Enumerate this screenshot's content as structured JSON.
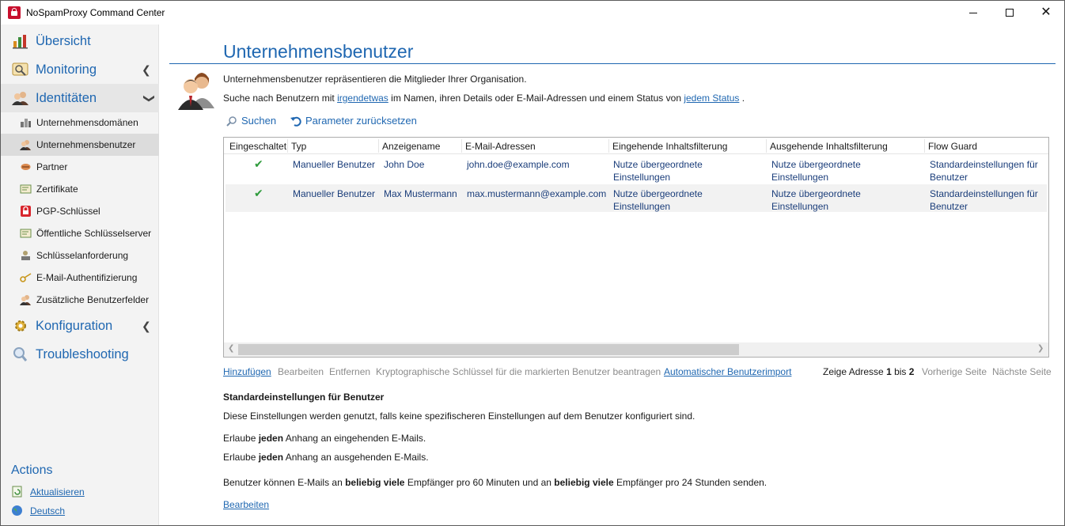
{
  "window": {
    "title": "NoSpamProxy Command Center"
  },
  "sidebar": {
    "main_items": [
      {
        "label": "Übersicht"
      },
      {
        "label": "Monitoring"
      },
      {
        "label": "Identitäten"
      },
      {
        "label": "Konfiguration"
      },
      {
        "label": "Troubleshooting"
      }
    ],
    "sub_items": [
      {
        "label": "Unternehmensdomänen"
      },
      {
        "label": "Unternehmensbenutzer"
      },
      {
        "label": "Partner"
      },
      {
        "label": "Zertifikate"
      },
      {
        "label": "PGP-Schlüssel"
      },
      {
        "label": "Öffentliche Schlüsselserver"
      },
      {
        "label": "Schlüsselanforderung"
      },
      {
        "label": "E-Mail-Authentifizierung"
      },
      {
        "label": "Zusätzliche Benutzerfelder"
      }
    ],
    "actions_title": "Actions",
    "actions": [
      {
        "label": "Aktualisieren"
      },
      {
        "label": "Deutsch"
      }
    ]
  },
  "main": {
    "title": "Unternehmensbenutzer",
    "intro": "Unternehmensbenutzer repräsentieren die Mitglieder Ihrer Organisation.",
    "search": {
      "prefix": "Suche nach Benutzern mit",
      "link1": "irgendetwas",
      "middle": "im Namen, ihren Details oder E-Mail-Adressen und einem Status von",
      "link2": "jedem Status",
      "suffix": "."
    },
    "toolbar": {
      "search_label": "Suchen",
      "reset_label": "Parameter zurücksetzen"
    },
    "grid": {
      "columns": [
        "Eingeschaltet",
        "Typ",
        "Anzeigename",
        "E-Mail-Adressen",
        "Eingehende Inhaltsfilterung",
        "Ausgehende Inhaltsfilterung",
        "Flow Guard"
      ],
      "rows": [
        {
          "enabled": true,
          "type": "Manueller Benutzer",
          "name": "John Doe",
          "email": "john.doe@example.com",
          "inbound_1": "Nutze übergeordnete",
          "inbound_2": "Einstellungen",
          "outbound_1": "Nutze übergeordnete",
          "outbound_2": "Einstellungen",
          "flow_1": "Standardeinstellungen für",
          "flow_2": "Benutzer"
        },
        {
          "enabled": true,
          "type": "Manueller Benutzer",
          "name": "Max Mustermann",
          "email": "max.mustermann@example.com",
          "inbound_1": "Nutze übergeordnete",
          "inbound_2": "Einstellungen",
          "outbound_1": "Nutze übergeordnete",
          "outbound_2": "Einstellungen",
          "flow_1": "Standardeinstellungen für",
          "flow_2": "Benutzer"
        }
      ]
    },
    "grid_actions": {
      "add": "Hinzufügen",
      "edit": "Bearbeiten",
      "remove": "Entfernen",
      "request_keys": "Kryptographische Schlüssel für die markierten Benutzer beantragen",
      "auto_import": "Automatischer Benutzerimport"
    },
    "pager": {
      "prefix": "Zeige Adresse",
      "from": "1",
      "to_word": "bis",
      "to": "2",
      "prev": "Vorherige Seite",
      "next": "Nächste Seite"
    },
    "defaults": {
      "title": "Standardeinstellungen für Benutzer",
      "desc": "Diese Einstellungen werden genutzt, falls keine spezifischeren Einstellungen auf dem Benutzer konfiguriert sind.",
      "inbound_prefix": "Erlaube",
      "inbound_bold": "jeden",
      "inbound_suffix": "Anhang an eingehenden E-Mails.",
      "outbound_prefix": "Erlaube",
      "outbound_bold": "jeden",
      "outbound_suffix": "Anhang an ausgehenden E-Mails.",
      "limit_1": "Benutzer können E-Mails an",
      "limit_bold1": "beliebig viele",
      "limit_2": "Empfänger pro 60 Minuten und an",
      "limit_bold2": "beliebig viele",
      "limit_3": "Empfänger pro 24 Stunden senden.",
      "edit": "Bearbeiten"
    }
  }
}
